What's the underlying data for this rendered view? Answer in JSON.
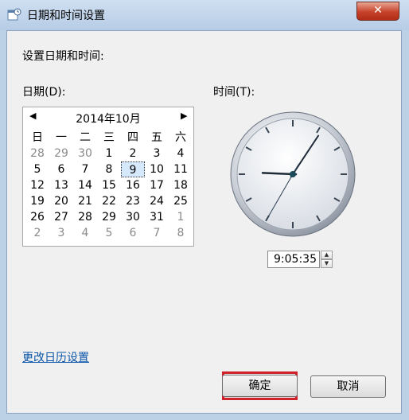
{
  "window": {
    "title": "日期和时间设置",
    "close_label": "✕"
  },
  "main": {
    "heading": "设置日期和时间:",
    "date_label": "日期(D):",
    "time_label": "时间(T):",
    "calendar_link": "更改日历设置"
  },
  "calendar": {
    "month_label": "2014年10月",
    "prev_icon": "◀",
    "next_icon": "▶",
    "weekdays": [
      "日",
      "一",
      "二",
      "三",
      "四",
      "五",
      "六"
    ],
    "weeks": [
      [
        "28",
        "29",
        "30",
        "1",
        "2",
        "3",
        "4"
      ],
      [
        "5",
        "6",
        "7",
        "8",
        "9",
        "10",
        "11"
      ],
      [
        "12",
        "13",
        "14",
        "15",
        "16",
        "17",
        "18"
      ],
      [
        "19",
        "20",
        "21",
        "22",
        "23",
        "24",
        "25"
      ],
      [
        "26",
        "27",
        "28",
        "29",
        "30",
        "31",
        "1"
      ],
      [
        "2",
        "3",
        "4",
        "5",
        "6",
        "7",
        "8"
      ]
    ],
    "selected_day": "9"
  },
  "time": {
    "value": "9:05:35",
    "spin_up": "▲",
    "spin_down": "▼",
    "hours": 9,
    "minutes": 5,
    "seconds": 35
  },
  "buttons": {
    "ok_label": "确定",
    "cancel_label": "取消"
  }
}
